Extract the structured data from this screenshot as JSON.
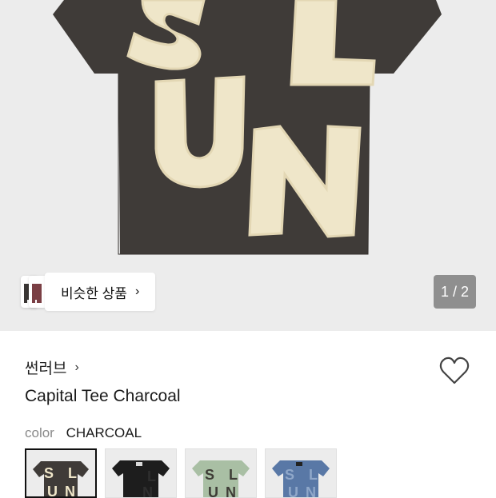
{
  "gallery": {
    "image_name": "t-shirt-front",
    "letters": [
      "S",
      "L",
      "U",
      "N"
    ],
    "counter": "1 / 2"
  },
  "similar": {
    "label": "비슷한 상품",
    "chevron": "›"
  },
  "product": {
    "brand": "썬러브",
    "brand_chevron": "›",
    "title": "Capital Tee Charcoal",
    "color_key": "color",
    "color_value": "CHARCOAL"
  },
  "swatches": [
    {
      "name": "charcoal",
      "shirt": "#3f3b38",
      "letter": "#efe6c9",
      "selected": true
    },
    {
      "name": "black",
      "shirt": "#1d1d1d",
      "letter": "#2c2c2c",
      "selected": false
    },
    {
      "name": "sage",
      "shirt": "#a9bfa4",
      "letter": "#3e3c36",
      "selected": false
    },
    {
      "name": "blue",
      "shirt": "#5978a6",
      "letter": "#8fa7c9",
      "selected": false
    }
  ],
  "colors": {
    "hero_bg": "#ececec",
    "shirt": "#3f3b38",
    "letter": "#efe6c9",
    "letter_edge": "#e6dab8"
  }
}
